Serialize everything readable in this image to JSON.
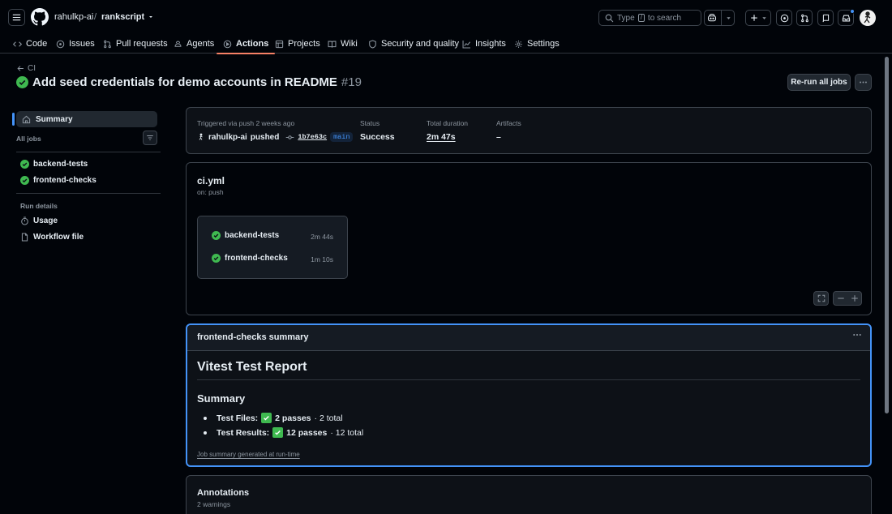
{
  "header": {
    "owner": "rahulkp-ai",
    "separator": "/",
    "repo": "rankscript",
    "search_prefix": "Type",
    "search_key": "/",
    "search_suffix": "to search"
  },
  "tabs": [
    {
      "label": "Code",
      "icon": "code-icon"
    },
    {
      "label": "Issues",
      "icon": "issue-opened-icon"
    },
    {
      "label": "Pull requests",
      "icon": "git-pull-request-icon"
    },
    {
      "label": "Agents",
      "icon": "agent-icon"
    },
    {
      "label": "Actions",
      "icon": "play-icon",
      "active": true
    },
    {
      "label": "Projects",
      "icon": "table-icon"
    },
    {
      "label": "Wiki",
      "icon": "book-icon"
    },
    {
      "label": "Security and quality",
      "icon": "shield-icon"
    },
    {
      "label": "Insights",
      "icon": "graph-icon"
    },
    {
      "label": "Settings",
      "icon": "gear-icon"
    }
  ],
  "run": {
    "back_label": "CI",
    "title": "Add seed credentials for demo accounts in README",
    "number": "#19",
    "rerun_label": "Re-run all jobs"
  },
  "sidebar": {
    "summary_label": "Summary",
    "all_jobs_label": "All jobs",
    "jobs": [
      {
        "name": "backend-tests",
        "status": "success"
      },
      {
        "name": "frontend-checks",
        "status": "success"
      }
    ],
    "run_details_label": "Run details",
    "details": [
      {
        "label": "Usage",
        "icon": "stopwatch-icon"
      },
      {
        "label": "Workflow file",
        "icon": "file-icon"
      }
    ]
  },
  "info": {
    "trigger_label": "Triggered via push 2 weeks ago",
    "actor": "rahulkp-ai",
    "action": "pushed",
    "commit": "1b7e63c",
    "branch": "main",
    "status_label": "Status",
    "status_value": "Success",
    "duration_label": "Total duration",
    "duration_value": "2m 47s",
    "artifacts_label": "Artifacts",
    "artifacts_value": "–"
  },
  "workflow": {
    "file": "ci.yml",
    "trigger": "on: push",
    "jobs": [
      {
        "name": "backend-tests",
        "duration": "2m 44s"
      },
      {
        "name": "frontend-checks",
        "duration": "1m 10s"
      }
    ]
  },
  "summary": {
    "header": "frontend-checks summary",
    "h1": "Vitest Test Report",
    "h2": "Summary",
    "items": [
      {
        "label": "Test Files:",
        "passes": "2 passes",
        "total": "· 2 total"
      },
      {
        "label": "Test Results:",
        "passes": "12 passes",
        "total": "· 12 total"
      }
    ],
    "note": "Job summary generated at run-time"
  },
  "annotations": {
    "title": "Annotations",
    "subtitle": "2 warnings"
  },
  "colors": {
    "success": "#3fb950",
    "accent": "#4493f8",
    "tab_underline": "#f78166"
  }
}
